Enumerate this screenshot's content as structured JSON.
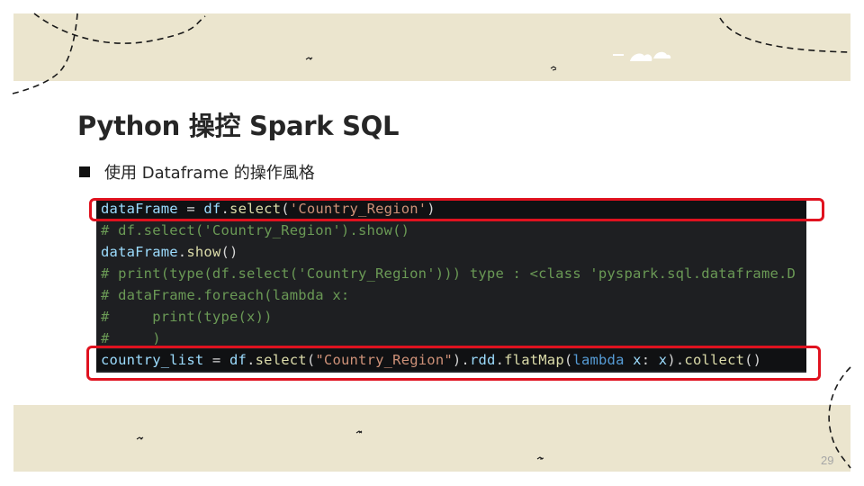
{
  "slide": {
    "title": "Python 操控 Spark SQL",
    "bullet": "使用 Dataframe 的操作風格",
    "page_number": "29"
  },
  "code": {
    "lines": [
      [
        [
          "var",
          "dataFrame"
        ],
        [
          "op",
          " = "
        ],
        [
          "var",
          "df"
        ],
        [
          "op",
          "."
        ],
        [
          "fn",
          "select"
        ],
        [
          "op",
          "("
        ],
        [
          "str",
          "'Country_Region'"
        ],
        [
          "op",
          ")"
        ]
      ],
      [
        [
          "com",
          "# df.select('Country_Region').show()"
        ]
      ],
      [
        [
          "var",
          "dataFrame"
        ],
        [
          "op",
          "."
        ],
        [
          "fn",
          "show"
        ],
        [
          "op",
          "()"
        ]
      ],
      [
        [
          "com",
          "# print(type(df.select('Country_Region'))) type : <class 'pyspark.sql.dataframe.D"
        ]
      ],
      [
        [
          "com",
          "# dataFrame.foreach(lambda x:"
        ]
      ],
      [
        [
          "com",
          "#     print(type(x))"
        ]
      ],
      [
        [
          "com",
          "#     )"
        ]
      ],
      [
        [
          "var",
          "country_list"
        ],
        [
          "op",
          " = "
        ],
        [
          "var",
          "df"
        ],
        [
          "op",
          "."
        ],
        [
          "fn",
          "select"
        ],
        [
          "op",
          "("
        ],
        [
          "str",
          "\"Country_Region\""
        ],
        [
          "op",
          ")."
        ],
        [
          "var",
          "rdd"
        ],
        [
          "op",
          "."
        ],
        [
          "fn",
          "flatMap"
        ],
        [
          "op",
          "("
        ],
        [
          "kw",
          "lambda"
        ],
        [
          "op",
          " "
        ],
        [
          "var",
          "x"
        ],
        [
          "op",
          ": "
        ],
        [
          "var",
          "x"
        ],
        [
          "op",
          ")."
        ],
        [
          "fn",
          "collect"
        ],
        [
          "op",
          "()"
        ]
      ]
    ],
    "highlighted_lines": [
      0,
      7
    ],
    "colors": {
      "background": "#1e1f22",
      "highlight_border": "#e0121f",
      "comment": "#6a9955",
      "string": "#ce9178",
      "variable": "#9cdcfe",
      "function": "#dcdcaa",
      "keyword": "#569cd6"
    }
  },
  "decor": {
    "band_color": "#ebe5ce",
    "icons": [
      "cloud-icon",
      "bird-icon"
    ]
  }
}
